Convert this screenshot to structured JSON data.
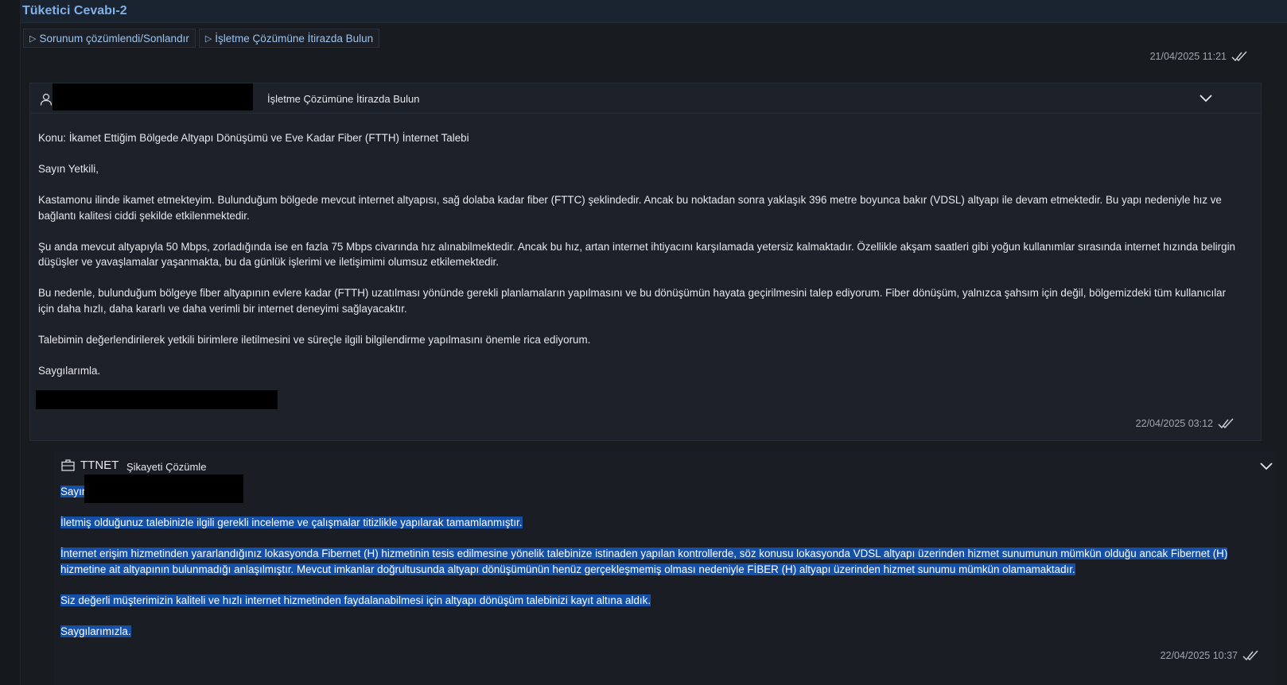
{
  "window": {
    "title": "Tüketici Cevabı-2"
  },
  "actions": [
    {
      "label": "Sorunum çözümlendi/Sonlandır"
    },
    {
      "label": "İşletme Çözümüne İtirazda Bulun"
    }
  ],
  "timestamps": {
    "top": "21/04/2025 11:21",
    "message": "22/04/2025 03:12",
    "reply": "22/04/2025 10:37"
  },
  "message": {
    "action_label": "İşletme Çözümüne İtirazda Bulun",
    "subject": "Konu: İkamet Ettiğim Bölgede Altyapı Dönüşümü ve Eve Kadar Fiber (FTTH) İnternet Talebi",
    "greeting": "Sayın Yetkili,",
    "p1": "Kastamonu ilinde ikamet etmekteyim. Bulunduğum bölgede mevcut internet altyapısı, sağ dolaba kadar fiber (FTTC) şeklindedir. Ancak bu noktadan sonra yaklaşık 396 metre boyunca bakır (VDSL) altyapı ile devam etmektedir. Bu yapı nedeniyle hız ve bağlantı kalitesi ciddi şekilde etkilenmektedir.",
    "p2": "Şu anda mevcut altyapıyla 50 Mbps, zorladığında ise en fazla 75 Mbps civarında hız alınabilmektedir. Ancak bu hız, artan internet ihtiyacını karşılamada yetersiz kalmaktadır. Özellikle akşam saatleri gibi yoğun kullanımlar sırasında internet hızında belirgin düşüşler ve yavaşlamalar yaşanmakta, bu da günlük işlerimi ve iletişimimi olumsuz etkilemektedir.",
    "p3": "Bu nedenle, bulunduğum bölgeye fiber altyapının evlere kadar (FTTH) uzatılması yönünde gerekli planlamaların yapılmasını ve bu dönüşümün hayata geçirilmesini talep ediyorum. Fiber dönüşüm, yalnızca şahsım için değil, bölgemizdeki tüm kullanıcılar için daha hızlı, daha kararlı ve daha verimli bir internet deneyimi sağlayacaktır.",
    "p4": "Talebimin değerlendirilerek yetkili birimlere iletilmesini ve süreçle ilgili bilgilendirme yapılmasını önemle rica ediyorum.",
    "closing": "Saygılarımla."
  },
  "reply": {
    "company": "TTNET",
    "action_label": "Şikayeti Çözümle",
    "greeting": "Sayın",
    "p1": "İletmiş olduğunuz talebinizle ilgili gerekli inceleme ve çalışmalar titizlikle yapılarak tamamlanmıştır.",
    "p2": "İnternet erişim hizmetinden yararlandığınız lokasyonda Fibernet (H) hizmetinin tesis edilmesine yönelik talebinize istinaden yapılan kontrollerde, söz konusu lokasyonda VDSL altyapı üzerinden hizmet sunumunun mümkün olduğu ancak Fibernet (H) hizmetine ait altyapının bulunmadığı anlaşılmıştır. Mevcut imkanlar doğrultusunda altyapı dönüşümünün henüz gerçekleşmemiş olması nedeniyle FİBER (H) altyapı üzerinden hizmet sunumu mümkün olamamaktadır.",
    "p3": "Siz değerli müşterimizin kaliteli ve hızlı internet hizmetinden faydalanabilmesi için altyapı dönüşüm talebinizi kayıt altına aldık.",
    "closing": "Saygılarımızla."
  },
  "colors": {
    "background": "#181b20",
    "accent": "#7fb0e8",
    "selection": "#1450a8",
    "redaction": "#000000"
  },
  "icons": [
    "triangle-right-icon",
    "user-icon",
    "chevron-down-icon",
    "briefcase-icon",
    "double-check-icon"
  ]
}
